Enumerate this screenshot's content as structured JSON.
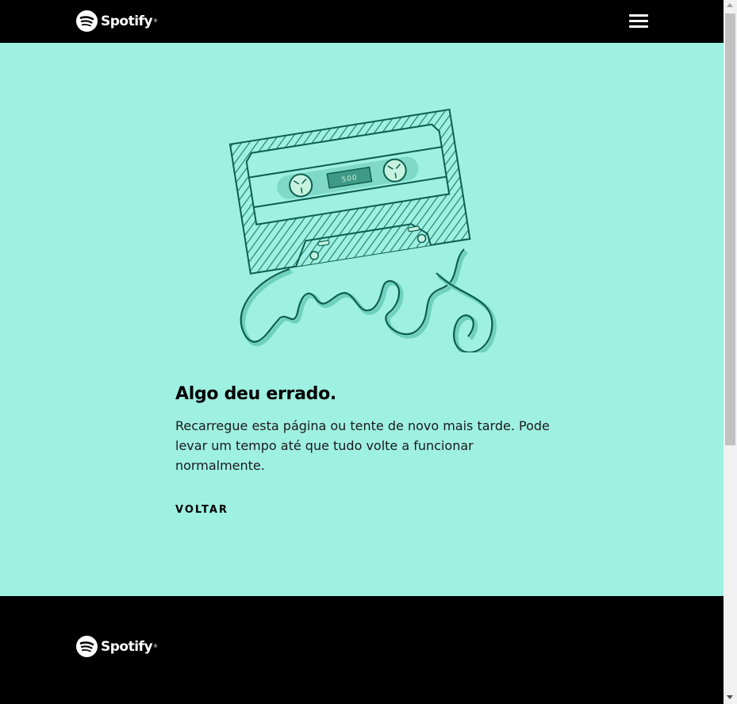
{
  "header": {
    "brand": "Spotify",
    "menu_icon": "hamburger-menu-icon"
  },
  "error": {
    "cassette_label": "500",
    "title": "Algo deu errado.",
    "message": "Recarregue esta página ou tente de novo mais tarde. Pode levar um tempo até que tudo volte a funcionar normalmente.",
    "back_link": "VOLTAR"
  },
  "footer": {
    "brand": "Spotify"
  },
  "colors": {
    "background": "#9ef0e1",
    "header": "#000000",
    "illustration_stroke": "#0d5e4e",
    "cassette_fill": "#7fd9c6"
  }
}
